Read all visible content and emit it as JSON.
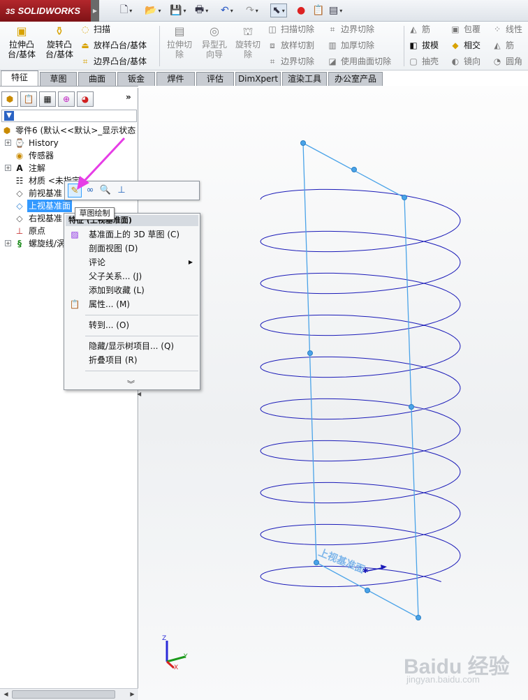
{
  "app": {
    "brand": "SOLIDWORKS",
    "brand_prefix": "3S"
  },
  "quick_toolbar": [
    "new-icon",
    "open-icon",
    "save-icon",
    "print-icon",
    "undo-icon",
    "redo-icon",
    "select-icon",
    "traffic-light-icon",
    "options-icon",
    "customize-icon"
  ],
  "ribbon": {
    "big": [
      {
        "l1": "拉伸凸",
        "l2": "台/基体"
      },
      {
        "l1": "旋转凸",
        "l2": "台/基体"
      },
      {
        "l1": "拉伸切",
        "l2": "除"
      },
      {
        "l1": "异型孔",
        "l2": "向导"
      },
      {
        "l1": "旋转切",
        "l2": "除"
      }
    ],
    "small_col1": [
      "扫描",
      "放样凸台/基体",
      "边界凸台/基体"
    ],
    "small_col2": [
      "扫描切除",
      "放样切割",
      "边界切除"
    ],
    "small_col3": [
      "边界切除",
      "加厚切除",
      "使用曲面切除"
    ],
    "small_col4": [
      "筋",
      "拔模",
      "抽壳"
    ],
    "small_col5": [
      "包覆",
      "相交",
      "镜向"
    ],
    "small_col6": [
      "线性",
      "筋",
      "圆角"
    ]
  },
  "tabs": [
    "特征",
    "草图",
    "曲面",
    "钣金",
    "焊件",
    "评估",
    "DimXpert",
    "渲染工具",
    "办公室产品"
  ],
  "tree": {
    "root": "零件6 (默认<<默认>_显示状态",
    "items": [
      "History",
      "传感器",
      "注解",
      "材质 <未指定",
      "前视基准",
      "上视基准面",
      "右视基准",
      "原点",
      "螺旋线/涡"
    ]
  },
  "context_toolbar_tooltip": "草图绘制",
  "menu": {
    "title": "特征 (上视基准面)",
    "items": [
      "基准面上的 3D 草图 (C)",
      "剖面视图 (D)",
      "评论",
      "父子关系... (J)",
      "添加到收藏 (L)",
      "属性... (M)",
      "转到... (O)",
      "隐藏/显示树项目... (Q)",
      "折叠项目 (R)"
    ]
  },
  "viewport": {
    "plane_label": "上视基准面",
    "triad": {
      "z": "Z",
      "y": "Y",
      "x": "X"
    }
  },
  "watermark": {
    "brand": "Baidu 经验",
    "url": "jingyan.baidu.com"
  },
  "colors": {
    "helix": "#1a1ab8",
    "plane": "#4aa3e8",
    "selection": "#3399ff",
    "highlight_arrow": "#e63de6"
  }
}
